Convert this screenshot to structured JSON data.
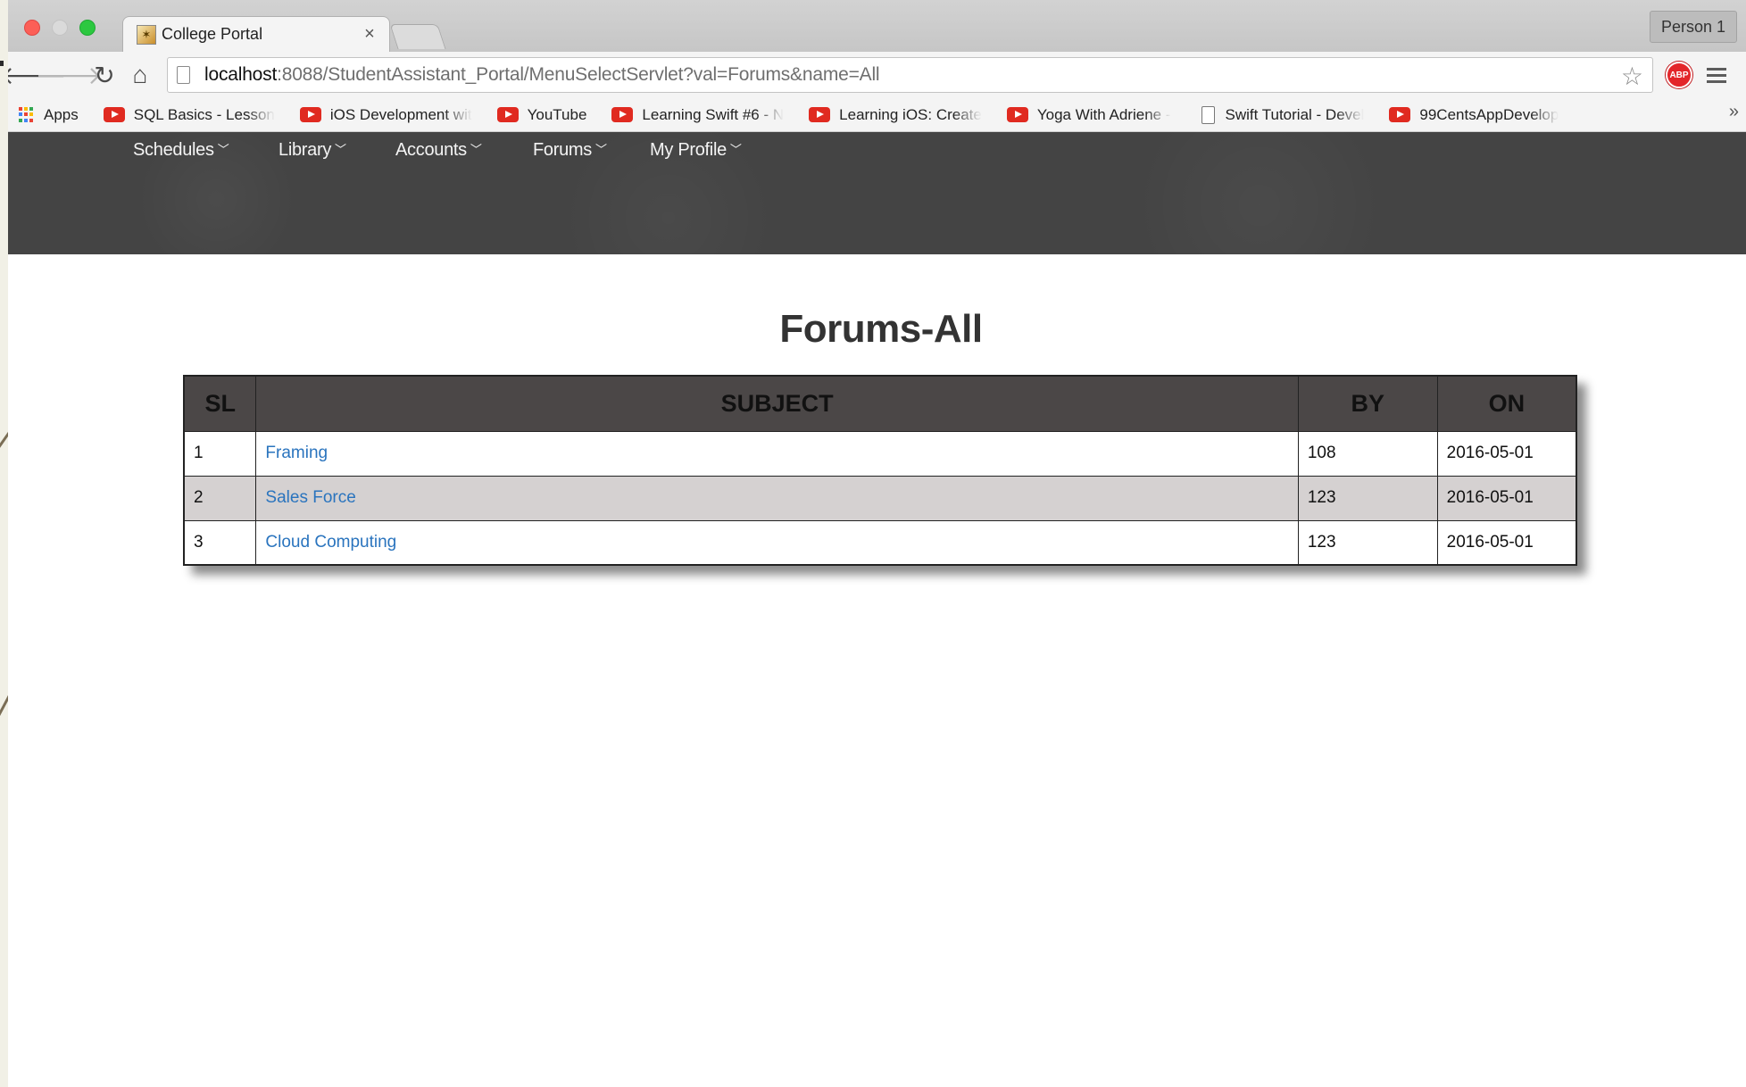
{
  "browser": {
    "tab_title": "College Portal",
    "tab_close": "×",
    "person": "Person 1",
    "url_host": "localhost",
    "url_rest": ":8088/StudentAssistant_Portal/MenuSelectServlet?val=Forums&name=All",
    "abp_label": "ABP",
    "bookmarks": [
      {
        "label": "Apps",
        "icon": "apps-icon"
      },
      {
        "label": "SQL Basics - Lesson",
        "icon": "youtube-icon"
      },
      {
        "label": "iOS Development wit",
        "icon": "youtube-icon"
      },
      {
        "label": "YouTube",
        "icon": "youtube-icon"
      },
      {
        "label": "Learning Swift #6 - N",
        "icon": "youtube-icon"
      },
      {
        "label": "Learning iOS: Create",
        "icon": "youtube-icon"
      },
      {
        "label": "Yoga With Adriene -",
        "icon": "youtube-icon"
      },
      {
        "label": "Swift Tutorial - Devel",
        "icon": "document-icon"
      },
      {
        "label": "99CentsAppDevelop",
        "icon": "youtube-icon"
      }
    ],
    "bookmarks_more": "»"
  },
  "nav": {
    "items": [
      {
        "label": "Schedules"
      },
      {
        "label": "Library"
      },
      {
        "label": "Accounts"
      },
      {
        "label": "Forums"
      },
      {
        "label": "My Profile"
      }
    ]
  },
  "page": {
    "title": "Forums-All"
  },
  "forums_table": {
    "headers": [
      "SL",
      "SUBJECT",
      "BY",
      "ON"
    ],
    "rows": [
      {
        "sl": "1",
        "subject": "Framing",
        "by": "108",
        "on": "2016-05-01"
      },
      {
        "sl": "2",
        "subject": "Sales Force",
        "by": "123",
        "on": "2016-05-01"
      },
      {
        "sl": "3",
        "subject": "Cloud Computing",
        "by": "123",
        "on": "2016-05-01"
      }
    ]
  },
  "colors": {
    "header_bg": "#444444",
    "table_head_bg": "#4b4747",
    "row_alt_bg": "#d5d1d1",
    "link": "#2a74be"
  }
}
